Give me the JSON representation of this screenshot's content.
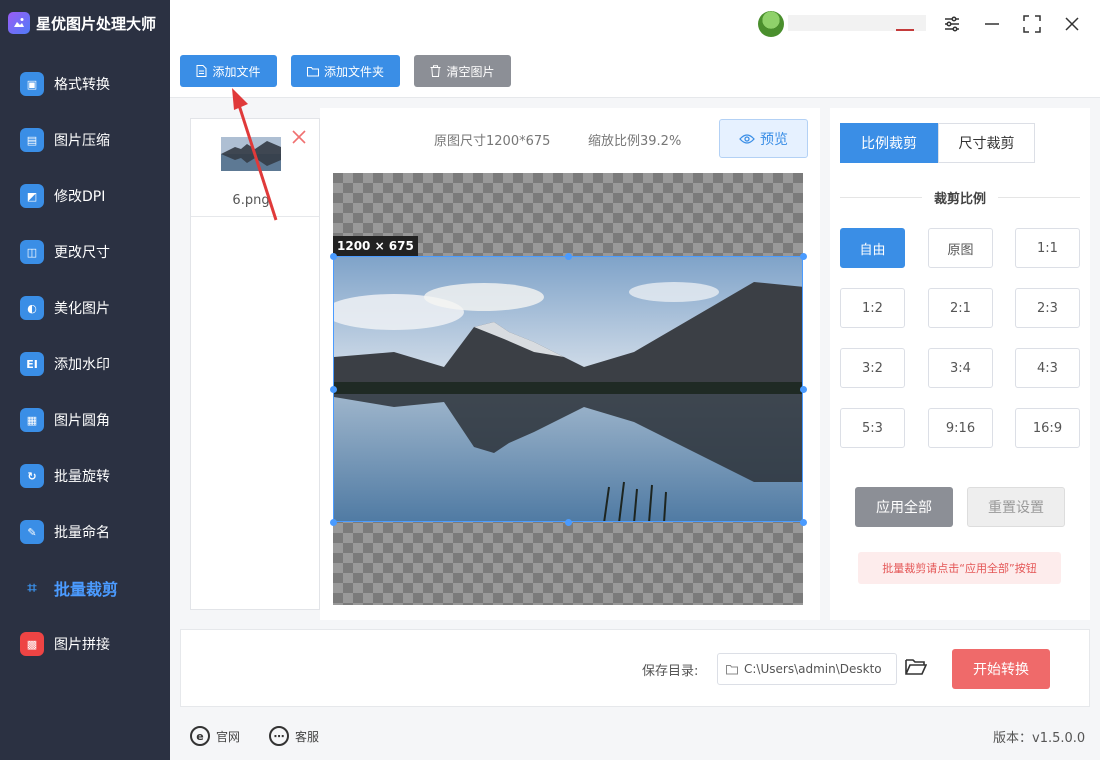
{
  "app": {
    "title": "星优图片处理大师"
  },
  "sidebar": {
    "items": [
      {
        "label": "格式转换",
        "icon": "image-convert-icon",
        "color": "#3a8ee6"
      },
      {
        "label": "图片压缩",
        "icon": "image-compress-icon",
        "color": "#3a8ee6"
      },
      {
        "label": "修改DPI",
        "icon": "dpi-icon",
        "color": "#3a8ee6"
      },
      {
        "label": "更改尺寸",
        "icon": "resize-icon",
        "color": "#3a8ee6"
      },
      {
        "label": "美化图片",
        "icon": "beautify-icon",
        "color": "#3a8ee6"
      },
      {
        "label": "添加水印",
        "icon": "watermark-icon",
        "color": "#3a8ee6"
      },
      {
        "label": "图片圆角",
        "icon": "rounded-corner-icon",
        "color": "#3a8ee6"
      },
      {
        "label": "批量旋转",
        "icon": "rotate-icon",
        "color": "#3a8ee6"
      },
      {
        "label": "批量命名",
        "icon": "rename-icon",
        "color": "#3a8ee6"
      },
      {
        "label": "批量裁剪",
        "icon": "crop-icon",
        "color": "#3a8ee6",
        "active": true
      },
      {
        "label": "图片拼接",
        "icon": "puzzle-icon",
        "color": "#e44"
      }
    ]
  },
  "toolbar": {
    "add_file": "添加文件",
    "add_folder": "添加文件夹",
    "clear_images": "清空图片"
  },
  "file_list": [
    {
      "name": "6.png"
    }
  ],
  "preview": {
    "original_size": "原图尺寸1200*675",
    "scale": "缩放比例39.2%",
    "preview_label": "预览",
    "size_tag": "1200 × 675"
  },
  "crop_settings": {
    "tabs": [
      "比例裁剪",
      "尺寸裁剪"
    ],
    "active_tab": 0,
    "section_title": "裁剪比例",
    "ratios": [
      "自由",
      "原图",
      "1:1",
      "1:2",
      "2:1",
      "2:3",
      "3:2",
      "3:4",
      "4:3",
      "5:3",
      "9:16",
      "16:9"
    ],
    "active_ratio": 0,
    "apply_all": "应用全部",
    "reset": "重置设置",
    "hint": "批量裁剪请点击“应用全部”按钮"
  },
  "save": {
    "label": "保存目录:",
    "path": "C:\\Users\\admin\\Deskto",
    "start": "开始转换"
  },
  "footer": {
    "website": "官网",
    "support": "客服",
    "version": "版本：v1.5.0.0"
  },
  "colors": {
    "accent": "#3a8ee6",
    "danger": "#ef6a6a",
    "sidebar": "#2b3142"
  }
}
